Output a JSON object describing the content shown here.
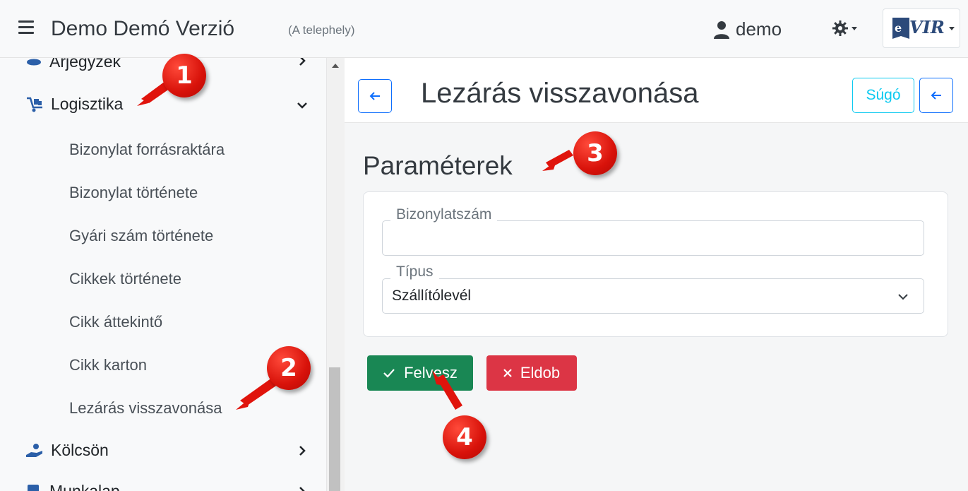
{
  "header": {
    "app_title": "Demo Demó Verzió",
    "site": "(A telephely)",
    "user": "demo",
    "brand": "eVIR"
  },
  "sidebar": {
    "items": [
      {
        "label": "Árjegyzék",
        "icon": "price-tag-icon"
      },
      {
        "label": "Logisztika",
        "icon": "logistics-icon",
        "expanded": true
      },
      {
        "label": "Kölcsön",
        "icon": "loan-hand-icon"
      },
      {
        "label": "Munkalap",
        "icon": "worksheet-icon"
      }
    ],
    "subitems": [
      "Bizonylat forrásraktára",
      "Bizonylat története",
      "Gyári szám története",
      "Cikkek története",
      "Cikk áttekintő",
      "Cikk karton",
      "Lezárás visszavonása"
    ]
  },
  "page": {
    "title": "Lezárás visszavonása",
    "help": "Súgó",
    "section_title": "Paraméterek",
    "fields": {
      "doc_number_label": "Bizonylatszám",
      "doc_number_value": "",
      "type_label": "Típus",
      "type_value": "Szállítólevél"
    },
    "buttons": {
      "save": "Felvesz",
      "discard": "Eldob"
    }
  },
  "markers": [
    "1",
    "2",
    "3",
    "4"
  ],
  "colors": {
    "primary": "#0d6efd",
    "info": "#0dcaf0",
    "success": "#198754",
    "danger": "#dc3545",
    "marker": "#e0140c"
  }
}
